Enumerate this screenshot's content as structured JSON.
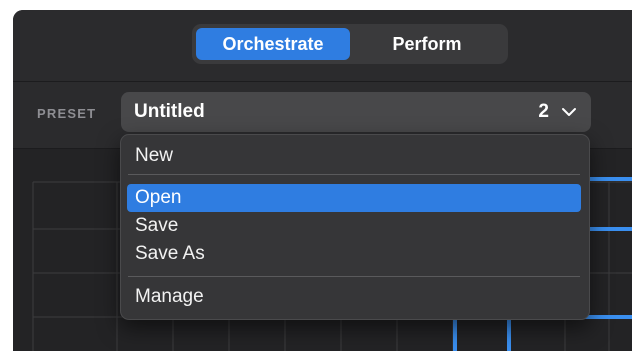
{
  "mode_switcher": {
    "tabs": [
      {
        "label": "Orchestrate",
        "active": true
      },
      {
        "label": "Perform",
        "active": false
      }
    ]
  },
  "preset": {
    "label": "PRESET",
    "name": "Untitled",
    "count": "2",
    "chevron_icon": "chevron-down-icon"
  },
  "dropdown": {
    "items": [
      {
        "label": "New",
        "selected": false
      },
      {
        "label": "Open",
        "selected": true
      },
      {
        "label": "Save",
        "selected": false
      },
      {
        "label": "Save As",
        "selected": false
      },
      {
        "label": "Manage",
        "selected": false
      }
    ]
  },
  "colors": {
    "accent": "#2f7de1",
    "background": "#2d2d2f",
    "grid_line": "#3c3c3e",
    "highlight_track": "#3a8ff0"
  }
}
